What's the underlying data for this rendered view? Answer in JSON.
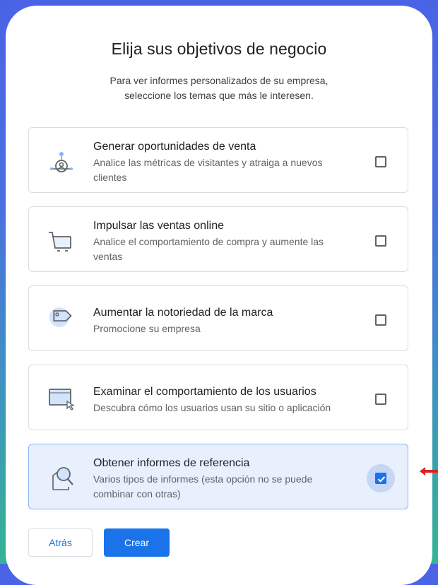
{
  "header": {
    "title": "Elija sus objetivos de negocio",
    "subtitle_line1": "Para ver informes personalizados de su empresa,",
    "subtitle_line2": "seleccione los temas que más le interesen."
  },
  "options": [
    {
      "title": "Generar oportunidades de venta",
      "desc_line1": "Analice las métricas de visitantes y atraiga a nuevos",
      "desc_line2": "clientes",
      "icon": "lead-target-icon",
      "checked": false
    },
    {
      "title": "Impulsar las ventas online",
      "desc_line1": "Analice el comportamiento de compra y aumente las",
      "desc_line2": "ventas",
      "icon": "shopping-cart-icon",
      "checked": false
    },
    {
      "title": "Aumentar la notoriedad de la marca",
      "desc_line1": "Promocione su empresa",
      "desc_line2": "",
      "icon": "tag-icon",
      "checked": false
    },
    {
      "title": "Examinar el comportamiento de los usuarios",
      "desc_line1": "Descubra cómo los usuarios usan su sitio o aplicación",
      "desc_line2": "",
      "icon": "browser-cursor-icon",
      "checked": false
    },
    {
      "title": "Obtener informes de referencia",
      "desc_line1": "Varios tipos de informes (esta opción no se puede",
      "desc_line2": "combinar con otras)",
      "icon": "report-magnifier-icon",
      "checked": true
    }
  ],
  "buttons": {
    "back": "Atrás",
    "create": "Crear"
  },
  "colors": {
    "accent": "#1a73e8",
    "arrow": "#e02020",
    "selected_bg": "#e8f0fe"
  }
}
